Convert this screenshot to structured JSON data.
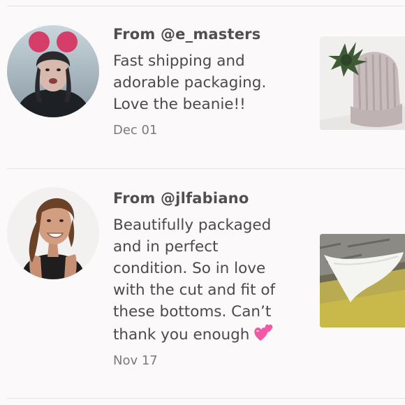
{
  "reviews": [
    {
      "from": "From @e_masters",
      "text_lines": [
        "Fast shipping and",
        "adorable packaging.",
        "Love the beanie!!"
      ],
      "date": "Dec 01",
      "avatar_icon": "user-avatar-photo",
      "thumb_icon": "beanie-product-photo"
    },
    {
      "from": "From @jlfabiano",
      "text_lines": [
        "Beautifully packaged",
        "and in perfect",
        "condition. So in love",
        "with the cut and fit of",
        "these bottoms. Can’t",
        "thank you enough"
      ],
      "emoji": "two-hearts-icon",
      "date": "Nov 17",
      "avatar_icon": "user-avatar-photo",
      "thumb_icon": "bikini-bottoms-product-photo"
    }
  ],
  "colors": {
    "background": "#fbf9fa",
    "divider": "#e6e3e4",
    "text": "#4a4a4a",
    "date": "#7a7a7a",
    "heart": "#f05aa5"
  }
}
